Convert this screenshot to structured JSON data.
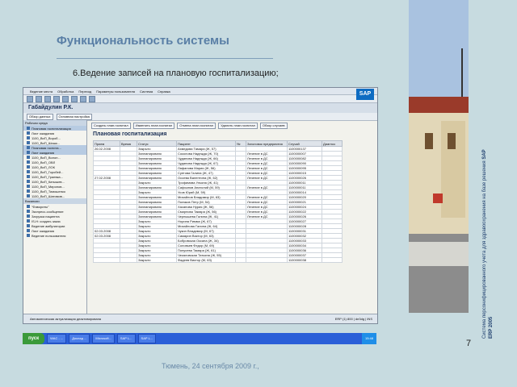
{
  "slide": {
    "title": "Функциональность системы",
    "subtitle": "6.Ведение записей на плановую госпитализацию;",
    "footer": "Тюмень, 24 сентября 2009 г.,",
    "page_number": "7",
    "side_text_1": "Система персонифицированного учета для здравоохранения на базе решения",
    "side_text_2": "SAP ERP 2005"
  },
  "sap": {
    "logo": "SAP",
    "menu": [
      "Ведение места",
      "Обработка",
      "Переход",
      "Параметры пользователя",
      "Система",
      "Справка"
    ],
    "user_title": "Габайдулин Р.К.",
    "toolbar_buttons": [
      "Обзор данных",
      "Основная настройка"
    ],
    "left_header_1": "Рабочая среда",
    "left_items_1": [
      "Плановая госпитализация",
      "Лист ожидания",
      "1100_ВиП_Вороб...",
      "1100_ВиП_Шишк...",
      "Плановая госпита...",
      "Лист ожидания",
      "1100_ВиП_Волон...",
      "1100_ВиП_ОВЛ",
      "1100_ВиП_ЛОК",
      "1100_ВиП_Горобей...",
      "1100_ВиП_Граевка...",
      "1100_ВиП_Катышев...",
      "1100_ВиП_Миронов...",
      "1100_ВиП_Тимошенко",
      "1100_ВиП_Шатимов..."
    ],
    "left_header_2": "Вакансии",
    "left_header_2b": "\"Фавориты\"",
    "left_items_2": [
      "Экспресс-сообщение",
      "Загрузка пациента",
      "IS-H: создать заказ",
      "Ведение амбулатории",
      "Лист ожидания",
      "Ведение пользователя"
    ],
    "action_buttons": [
      "Создать план.госпитал",
      "Изменить план.госпитал",
      "Отмена план.госпитал",
      "Удалить план.госпитал",
      "Обзор случаев"
    ],
    "panel_title": "Плановая госпитализация",
    "columns": [
      "Прием",
      "Время",
      "Статус",
      "Пациент",
      "№",
      "Заголовок предприятия",
      "Случай",
      "Диагноз"
    ],
    "rows": [
      [
        "26.02.2008",
        "",
        "Закрыто",
        "Ахмедова Тамара (Ж, 57)",
        "",
        "",
        "1100000137",
        ""
      ],
      [
        "",
        "",
        "Запланировано",
        "Соколова Надежда (Ж, 70)",
        "",
        "Лечение в ДС",
        "1100000007",
        ""
      ],
      [
        "",
        "",
        "Запланировано",
        "Чуданова Надежда (Ж, 66)",
        "",
        "Лечение в ДС",
        "1100000082",
        ""
      ],
      [
        "",
        "",
        "Запланировано",
        "Чуданова Надежда (Ж, 67)",
        "",
        "Лечение в ДС",
        "1100000090",
        ""
      ],
      [
        "",
        "",
        "Запланировано",
        "Лафанова Мария (Ж, 56)",
        "",
        "Лечение в ДС",
        "1100000095",
        ""
      ],
      [
        "",
        "",
        "Запланировано",
        "Суетова Галина (Ж, 47)",
        "",
        "Лечение в ДС",
        "1100000015",
        ""
      ],
      [
        "27.02.2008",
        "",
        "Запланировано",
        "Осоева Валентина (Ж, 62)",
        "",
        "Лечение в ДС",
        "1100000026",
        ""
      ],
      [
        "",
        "",
        "Закрыто",
        "Трофимова Ульяна (Ж, 41)",
        "",
        "",
        "1100000011",
        ""
      ],
      [
        "",
        "",
        "Запланировано",
        "Сафьянов Анатолий (М, 59)",
        "",
        "Лечение в ДС",
        "1100000011",
        ""
      ],
      [
        "",
        "",
        "Закрыто",
        "Усов Юрий (М, 59)",
        "",
        "",
        "1100000014",
        ""
      ],
      [
        "",
        "",
        "Запланировано",
        "Михайлов Владимир (М, 63)",
        "",
        "Лечение в ДС",
        "1100000020",
        ""
      ],
      [
        "",
        "",
        "Запланировано",
        "Поляков Петр (М, 54)",
        "",
        "Лечение в ДС",
        "1100000021",
        ""
      ],
      [
        "",
        "",
        "Запланировано",
        "Хасанова Нурия (Ж, 56)",
        "",
        "Лечение в ДС",
        "1100000024",
        ""
      ],
      [
        "",
        "",
        "Запланировано",
        "Смирнова Тамара (Ж, 56)",
        "",
        "Лечение в ДС",
        "1100000022",
        ""
      ],
      [
        "",
        "",
        "Запланировано",
        "Чернышева Галина (Ж, 41)",
        "",
        "Лечение в ДС",
        "1100000026",
        ""
      ],
      [
        "",
        "",
        "Закрыто",
        "Норина Римма (Ж, 67)",
        "",
        "",
        "1100000027",
        ""
      ],
      [
        "",
        "",
        "Закрыто",
        "Михайлова Галина (Ж, 64)",
        "",
        "",
        "1100000028",
        ""
      ],
      [
        "02.03.2008",
        "",
        "Закрыто",
        "Чукин Владимир (М, 67)",
        "",
        "",
        "1100000031",
        ""
      ],
      [
        "02.03.2008",
        "",
        "Закрыто",
        "Самарин Виктор (М, 63)",
        "",
        "",
        "1100000032",
        ""
      ],
      [
        "",
        "",
        "Закрыто",
        "Бобровская Оксана (Ж, 34)",
        "",
        "",
        "1100000033",
        ""
      ],
      [
        "",
        "",
        "Закрыто",
        "Соловьев Федор (М, 69)",
        "",
        "",
        "1100000034",
        ""
      ],
      [
        "",
        "",
        "Закрыто",
        "Понусева Тамара (Ж, 61)",
        "",
        "",
        "1100000036",
        ""
      ],
      [
        "",
        "",
        "Закрыто",
        "Чекаловская Татьяна (Ж, 55)",
        "",
        "",
        "1100000037",
        ""
      ],
      [
        "",
        "",
        "Закрыто",
        "Фадеев Виктор (М, 63)",
        "",
        "",
        "1100000038",
        ""
      ]
    ],
    "status_message": "Автоматическая актуализация деактивирована",
    "status_right": "ERP (1) 800 | de3dg | INS"
  },
  "taskbar": {
    "start": "пуск",
    "tasks": [
      "",
      "WAC - ...",
      "Доклад ...",
      "Microsoft...",
      "SAP L...",
      "SAP L...",
      "",
      ""
    ],
    "clock": "15:48"
  }
}
